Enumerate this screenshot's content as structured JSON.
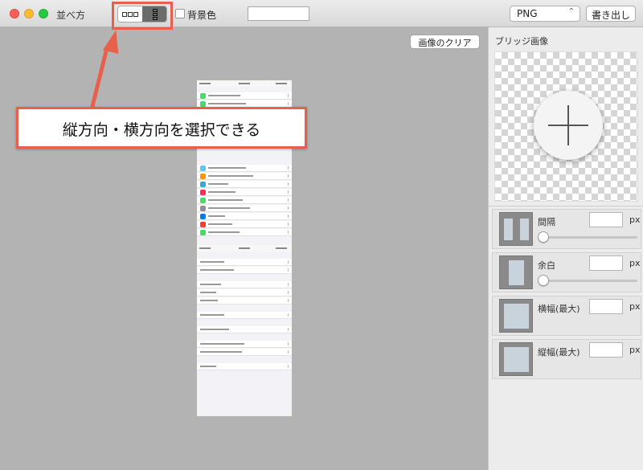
{
  "window": {
    "title": "並べ方"
  },
  "toolbar": {
    "layout_toggle": {
      "options": [
        "horizontal",
        "vertical"
      ],
      "selected": "vertical"
    },
    "background_label": "背景色",
    "background_checked": false,
    "format": {
      "selected": "PNG"
    },
    "export_label": "書き出し"
  },
  "canvas": {
    "clear_label": "画像のクリア"
  },
  "callout": {
    "text": "縦方向・横方向を選択できる",
    "color": "#e8604c"
  },
  "panel": {
    "bridge_title": "ブリッジ画像",
    "rows": [
      {
        "label": "間隔",
        "unit": "px",
        "value": "",
        "has_slider": true,
        "slider_value": 0
      },
      {
        "label": "余白",
        "unit": "px",
        "value": "",
        "has_slider": true,
        "slider_value": 0
      },
      {
        "label": "横幅(最大)",
        "unit": "px",
        "value": "",
        "has_slider": false
      },
      {
        "label": "縦幅(最大)",
        "unit": "px",
        "value": "",
        "has_slider": false
      }
    ]
  }
}
